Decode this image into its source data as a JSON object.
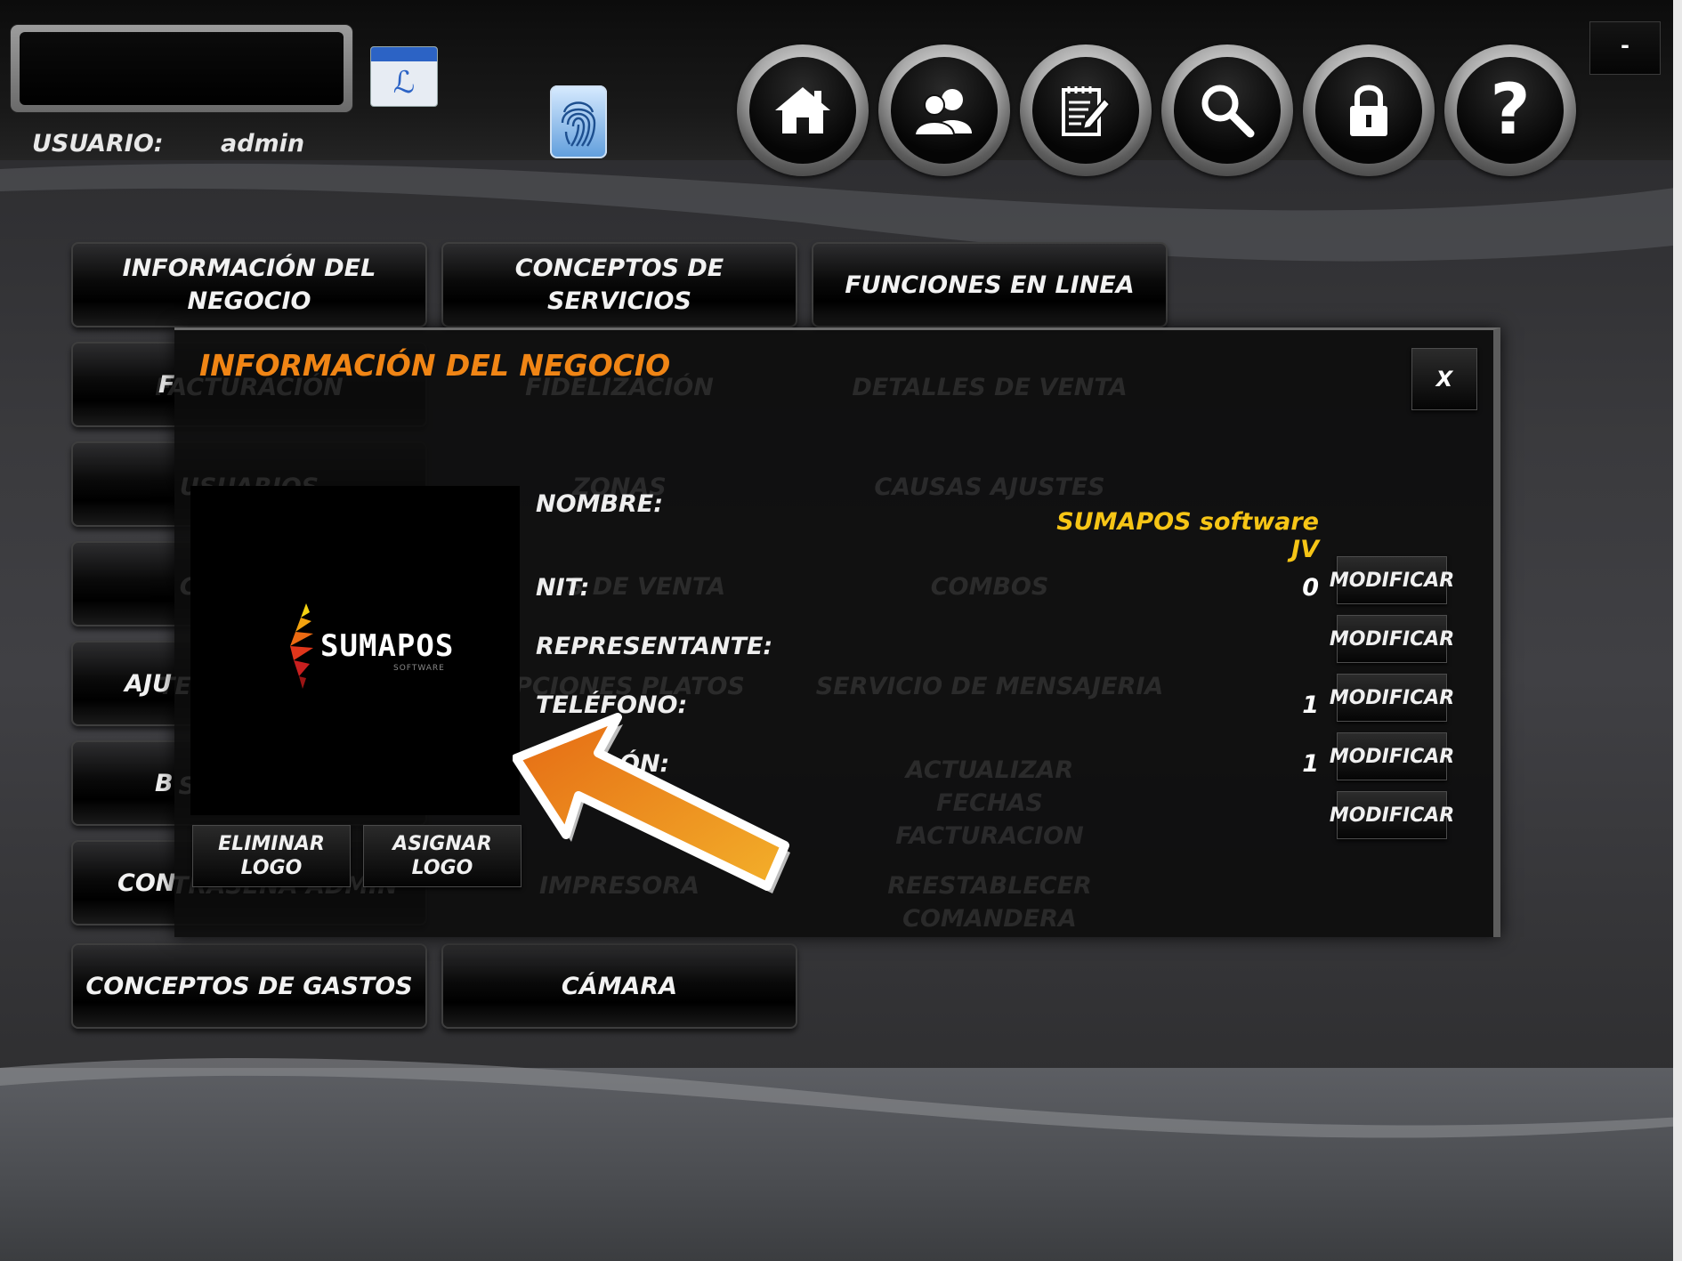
{
  "header": {
    "user_label": "USUARIO:",
    "user_name": "admin",
    "minimize_label": "-",
    "nav_icons": [
      "home-icon",
      "users-icon",
      "notepad-edit-icon",
      "search-icon",
      "lock-icon",
      "help-icon"
    ],
    "help_glyph": "?"
  },
  "menu": {
    "row1": [
      "INFORMACIÓN DEL NEGOCIO",
      "CONCEPTOS DE SERVICIOS",
      "FUNCIONES EN LINEA"
    ],
    "partial_left": [
      "F",
      "AJU",
      "B",
      "CON"
    ],
    "row_last": [
      "CONCEPTOS DE GASTOS",
      "CÁMARA"
    ],
    "ghost_col1": [
      "FACTURACIÓN",
      "USUARIOS",
      "COMANDA",
      "TES GENERALES",
      "SE DE DATOS",
      "TRASEÑA ADMIN"
    ],
    "ghost_col2": [
      "FIDELIZACIÓN",
      "ZONAS",
      "S DE VENTA",
      "OPCIONES PLATOS",
      "IMPRESORA"
    ],
    "ghost_col3": [
      "DETALLES DE VENTA",
      "CAUSAS AJUSTES",
      "COMBOS",
      "SERVICIO DE MENSAJERIA",
      "ACTUALIZAR FECHAS FACTURACION",
      "REESTABLECER COMANDERA"
    ]
  },
  "modal": {
    "title": "INFORMACIÓN DEL NEGOCIO",
    "close_label": "X",
    "logo": {
      "brand": "SUMAPOS",
      "sub": "SOFTWARE"
    },
    "eliminar_logo": "ELIMINAR LOGO",
    "asignar_logo": "ASIGNAR LOGO",
    "fields": {
      "nombre_label": "NOMBRE:",
      "nombre_value": "SUMAPOS software  JV",
      "nit_label": "NIT:",
      "nit_value": "0",
      "representante_label": "REPRESENTANTE:",
      "telefono_label": "TELÉFONO:",
      "telefono_value": "1",
      "direccion_label": "ÓN:",
      "direccion_value": "1"
    },
    "modificar_label": "MODIFICAR"
  },
  "colors": {
    "title_orange": "#f08515",
    "name_yellow": "#f6c516",
    "arrow_orange": "#f08a14"
  }
}
